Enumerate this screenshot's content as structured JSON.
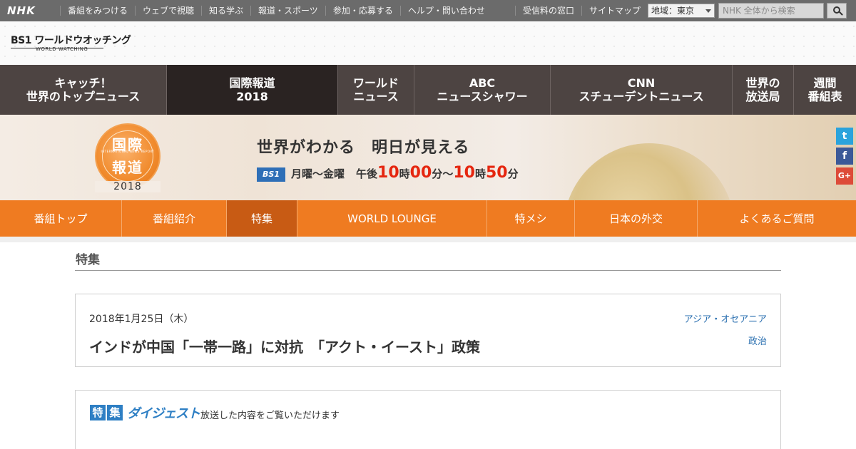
{
  "topbar": {
    "logo": "NHK",
    "nav": [
      "番組をみつける",
      "ウェブで視聴",
      "知る学ぶ",
      "報道・スポーツ",
      "参加・応募する",
      "ヘルプ・問い合わせ"
    ],
    "right_links": [
      "受信料の窓口",
      "サイトマップ"
    ],
    "region_label": "地域：東京",
    "search_placeholder": "NHK 全体から検索",
    "search_icon": "search-icon"
  },
  "brand": {
    "title": "BS1 ワールドウオッチング",
    "subtitle": "WORLD WATCHING"
  },
  "program_nav": [
    "キャッチ！\n世界のトップニュース",
    "国際報道\n2018",
    "ワールド\nニュース",
    "ABC\nニュースシャワー",
    "CNN\nスチューデントニュース",
    "世界の\n放送局",
    "週間\n番組表"
  ],
  "program_nav_active": 1,
  "hero": {
    "emblem_line1": "国際",
    "emblem_line2": "報道",
    "emblem_small": "INTERNATIONAL NEWS REPORT",
    "emblem_year": "2018",
    "tagline": "世界がわかる　明日が見える",
    "channel": "BS1",
    "days": "月曜〜金曜",
    "time_prefix": "午後",
    "start_hour": "10",
    "hour_unit": "時",
    "start_min": "00",
    "min_unit": "分",
    "tilde": "〜",
    "end_hour": "10",
    "end_min": "50",
    "social": [
      "twitter-icon",
      "facebook-icon",
      "google-plus-icon"
    ]
  },
  "orange_nav": [
    "番組トップ",
    "番組紹介",
    "特集",
    "WORLD LOUNGE",
    "特メシ",
    "日本の外交",
    "よくあるご質問"
  ],
  "orange_nav_active": 2,
  "section": {
    "title": "特集"
  },
  "article": {
    "date": "2018年1月25日（木）",
    "headline": "インドが中国「一帯一路」に対抗　「アクト・イースト」政策",
    "tags": [
      "アジア・オセアニア",
      "政治"
    ]
  },
  "digest": {
    "badge_kanji": [
      "特",
      "集"
    ],
    "badge_kana": "ダイジェスト",
    "description": "放送した内容をご覧いただけます"
  },
  "colors": {
    "orange_nav": "#ef7b21",
    "orange_active": "#c85b14",
    "dark_nav": "#4d4442",
    "dark_active": "#2a2322",
    "link_blue": "#2a6fb0",
    "time_red": "#e5260f"
  }
}
